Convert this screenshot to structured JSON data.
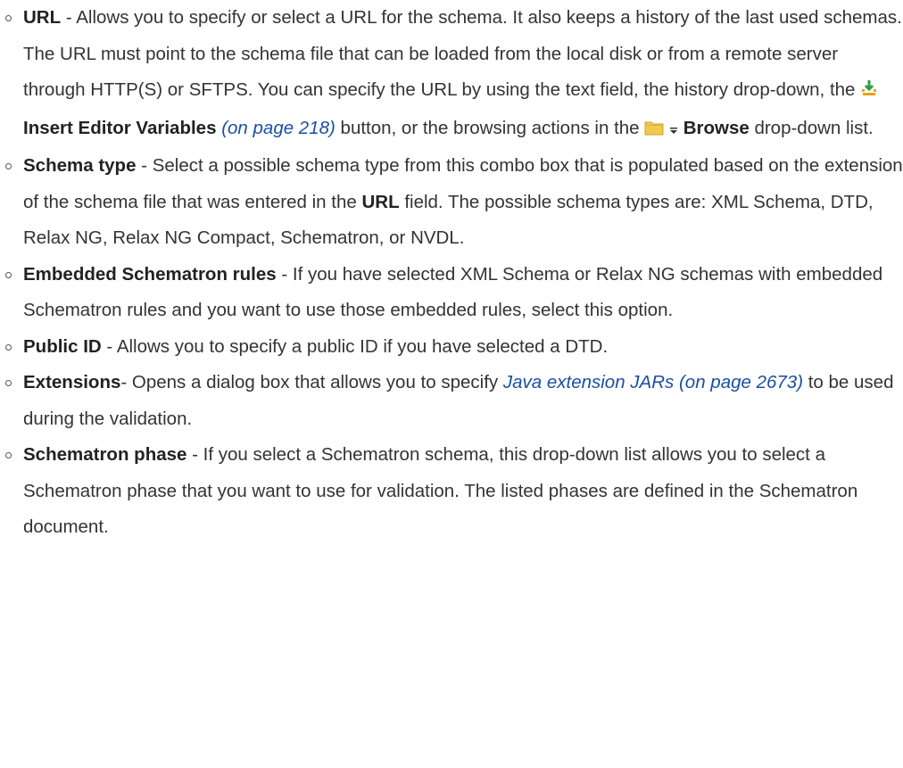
{
  "items": [
    {
      "term": "URL",
      "sep": " - ",
      "text1": "Allows you to specify or select a URL for the schema. It also keeps a history of the last used schemas. The URL must point to the schema file that can be loaded from the local disk or from a remote server through HTTP(S) or SFTPS. You can specify the URL by using the text field, the history drop-down, the ",
      "icon1": "insert-variables-icon",
      "link1": "Insert Editor Variables",
      "xref1": "(on page 218)",
      "text2": " button, or the browsing actions in the ",
      "icon2": "folder-icon",
      "icon3": "dropdown-arrow-icon",
      "bold2": "Browse",
      "text3": " drop-down list."
    },
    {
      "term": "Schema type",
      "sep": " - ",
      "text1": "Select a possible schema type from this combo box that is populated based on the extension of the schema file that was entered in the ",
      "bold2": "URL",
      "text2": " field. The possible schema types are: XML Schema, DTD, Relax NG, Relax NG Compact, Schematron, or NVDL."
    },
    {
      "term": "Embedded Schematron rules",
      "sep": " - ",
      "text1": "If you have selected XML Schema or Relax NG schemas with embedded Schematron rules and you want to use those embedded rules, select this option."
    },
    {
      "term": "Public ID",
      "sep": " - ",
      "text1": "Allows you to specify a public ID if you have selected a DTD."
    },
    {
      "term": "Extensions",
      "sep": "- ",
      "text1": "Opens a dialog box that allows you to specify ",
      "xref1": "Java extension JARs (on page 2673)",
      "text2": " to be used during the validation."
    },
    {
      "term": "Schematron phase",
      "sep": " - ",
      "text1": "If you select a Schematron schema, this drop-down list allows you to select a Schematron phase that you want to use for validation. The listed phases are defined in the Schematron document."
    }
  ],
  "colors": {
    "text": "#333333",
    "link": "#1a4fa3",
    "folder": "#f2c94c",
    "download": "#e8a317"
  }
}
